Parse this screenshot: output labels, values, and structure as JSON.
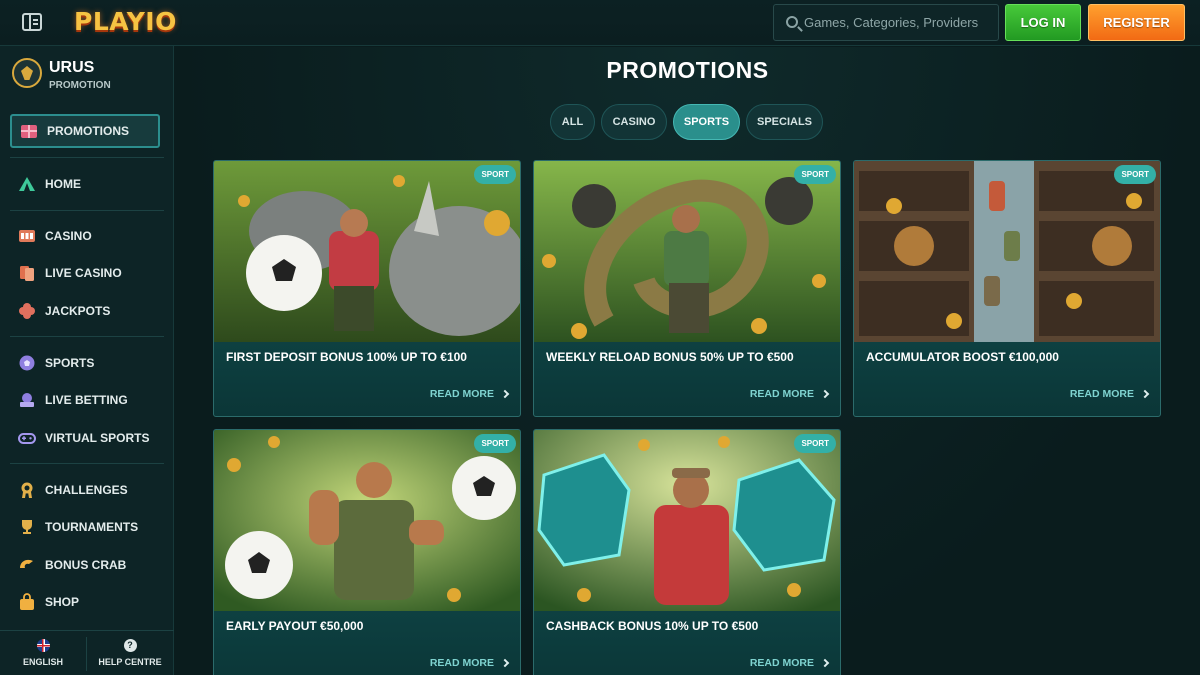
{
  "header": {
    "logo_text": "PLAYIO",
    "search_placeholder": "Games, Categories, Providers",
    "login_label": "LOG IN",
    "register_label": "REGISTER"
  },
  "sidebar": {
    "brand_name": "URUS",
    "brand_sub": "PROMOTION",
    "items": [
      {
        "label": "PROMOTIONS",
        "icon": "gift-icon",
        "active": true
      },
      {
        "label": "HOME",
        "icon": "tent-icon"
      },
      {
        "label": "CASINO",
        "icon": "slot-machine-icon"
      },
      {
        "label": "LIVE CASINO",
        "icon": "cards-icon"
      },
      {
        "label": "JACKPOTS",
        "icon": "clover-icon"
      },
      {
        "label": "SPORTS",
        "icon": "football-icon"
      },
      {
        "label": "LIVE BETTING",
        "icon": "live-tv-icon"
      },
      {
        "label": "VIRTUAL SPORTS",
        "icon": "gamepad-icon"
      },
      {
        "label": "CHALLENGES",
        "icon": "medal-icon"
      },
      {
        "label": "TOURNAMENTS",
        "icon": "trophy-icon"
      },
      {
        "label": "BONUS CRAB",
        "icon": "crab-claw-icon"
      },
      {
        "label": "SHOP",
        "icon": "shopping-bag-icon"
      }
    ],
    "footer": {
      "language_label": "ENGLISH",
      "help_label": "HELP CENTRE"
    }
  },
  "main": {
    "title": "PROMOTIONS",
    "filters": [
      {
        "label": "ALL",
        "active": false
      },
      {
        "label": "CASINO",
        "active": false
      },
      {
        "label": "SPORTS",
        "active": true
      },
      {
        "label": "SPECIALS",
        "active": false
      }
    ],
    "cards": [
      {
        "badge": "SPORT",
        "title": "FIRST DEPOSIT BONUS 100% UP TO €100",
        "cta": "READ MORE"
      },
      {
        "badge": "SPORT",
        "title": "WEEKLY RELOAD BONUS 50% UP TO €500",
        "cta": "READ MORE"
      },
      {
        "badge": "SPORT",
        "title": "ACCUMULATOR BOOST €100,000",
        "cta": "READ MORE"
      },
      {
        "badge": "SPORT",
        "title": "EARLY PAYOUT €50,000",
        "cta": "READ MORE"
      },
      {
        "badge": "SPORT",
        "title": "CASHBACK BONUS 10% UP TO €500",
        "cta": "READ MORE"
      }
    ]
  },
  "colors": {
    "accent_teal": "#2a8f8c",
    "login_green": "#229a22",
    "register_orange": "#f26a14",
    "logo_gold": "#f6c343"
  }
}
